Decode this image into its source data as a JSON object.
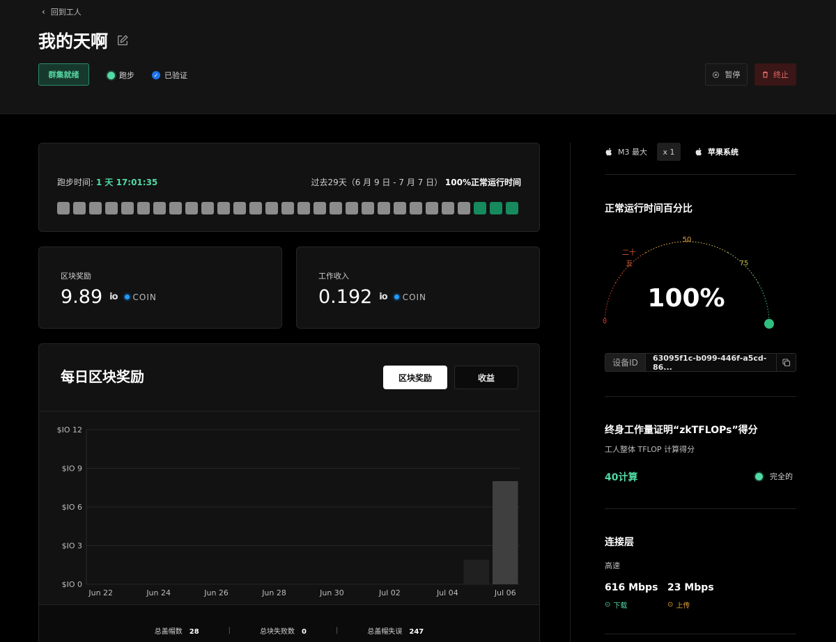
{
  "header": {
    "back_label": "回到工人",
    "title": "我的天啊",
    "badge": "群集就绪",
    "status_running": "跑步",
    "status_verified": "已验证",
    "pause_label": "暂停",
    "stop_label": "终止"
  },
  "uptime": {
    "label": "跑步时间:",
    "value": "1 天 17:01:35",
    "range": "过去29天（6 月 9 日 - 7 月 7 日）",
    "percent_text": "100%正常运行时间",
    "days": [
      0,
      0,
      0,
      0,
      0,
      0,
      0,
      0,
      0,
      0,
      0,
      0,
      0,
      0,
      0,
      0,
      0,
      0,
      0,
      0,
      0,
      0,
      0,
      0,
      0,
      0,
      1,
      1,
      1
    ]
  },
  "stats": {
    "block_reward_label": "区块奖励",
    "block_reward_value": "9.89",
    "work_income_label": "工作收入",
    "work_income_value": "0.192",
    "io_mark": "io",
    "coin_label": "COIN"
  },
  "chart": {
    "title": "每日区块奖励",
    "tab_active": "区块奖励",
    "tab_inactive": "收益"
  },
  "chart_data": {
    "type": "bar",
    "title": "每日区块奖励",
    "xlabel": "",
    "ylabel": "",
    "ylim": [
      0,
      12
    ],
    "y_ticks": [
      "$IO 0",
      "$IO 3",
      "$IO 6",
      "$IO 9",
      "$IO 12"
    ],
    "x_tick_labels": [
      "Jun 22",
      "Jun 24",
      "Jun 26",
      "Jun 28",
      "Jun 30",
      "Jul 02",
      "Jul 04",
      "Jul 06"
    ],
    "categories": [
      "Jun 22",
      "Jun 23",
      "Jun 24",
      "Jun 25",
      "Jun 26",
      "Jun 27",
      "Jun 28",
      "Jun 29",
      "Jun 30",
      "Jul 01",
      "Jul 02",
      "Jul 03",
      "Jul 04",
      "Jul 05",
      "Jul 06"
    ],
    "values": [
      0,
      0,
      0,
      0,
      0,
      0,
      0,
      0,
      0,
      0,
      0,
      0,
      0,
      1.9,
      8.0
    ],
    "grid": true
  },
  "footer": {
    "total_caps_label": "总盖帽数",
    "total_caps_value": "28",
    "failed_blocks_label": "总块失败数",
    "failed_blocks_value": "0",
    "cap_errors_label": "总盖帽失误",
    "cap_errors_value": "247"
  },
  "right": {
    "chip": "M3 最大",
    "count": "x 1",
    "os": "苹果系统",
    "uptime_title": "正常运行时间百分比",
    "gauge_value": "100%",
    "gauge_percent": 100,
    "gauge_label_0": "0",
    "gauge_label_25a": "二十",
    "gauge_label_25b": "五",
    "gauge_label_50": "50",
    "gauge_label_75": "75",
    "device_label": "设备ID",
    "device_id": "63095f1c-b099-446f-a5cd-86...",
    "zk_title": "终身工作量证明“zkTFLOPs”得分",
    "zk_sub": "工人整体 TFLOP 计算得分",
    "zk_score": "40计算",
    "zk_status": "完全的",
    "conn_title": "连接层",
    "conn_sub": "高速",
    "download_value": "616 Mbps",
    "download_label": "下载",
    "upload_value": "23 Mbps",
    "upload_label": "上传"
  }
}
